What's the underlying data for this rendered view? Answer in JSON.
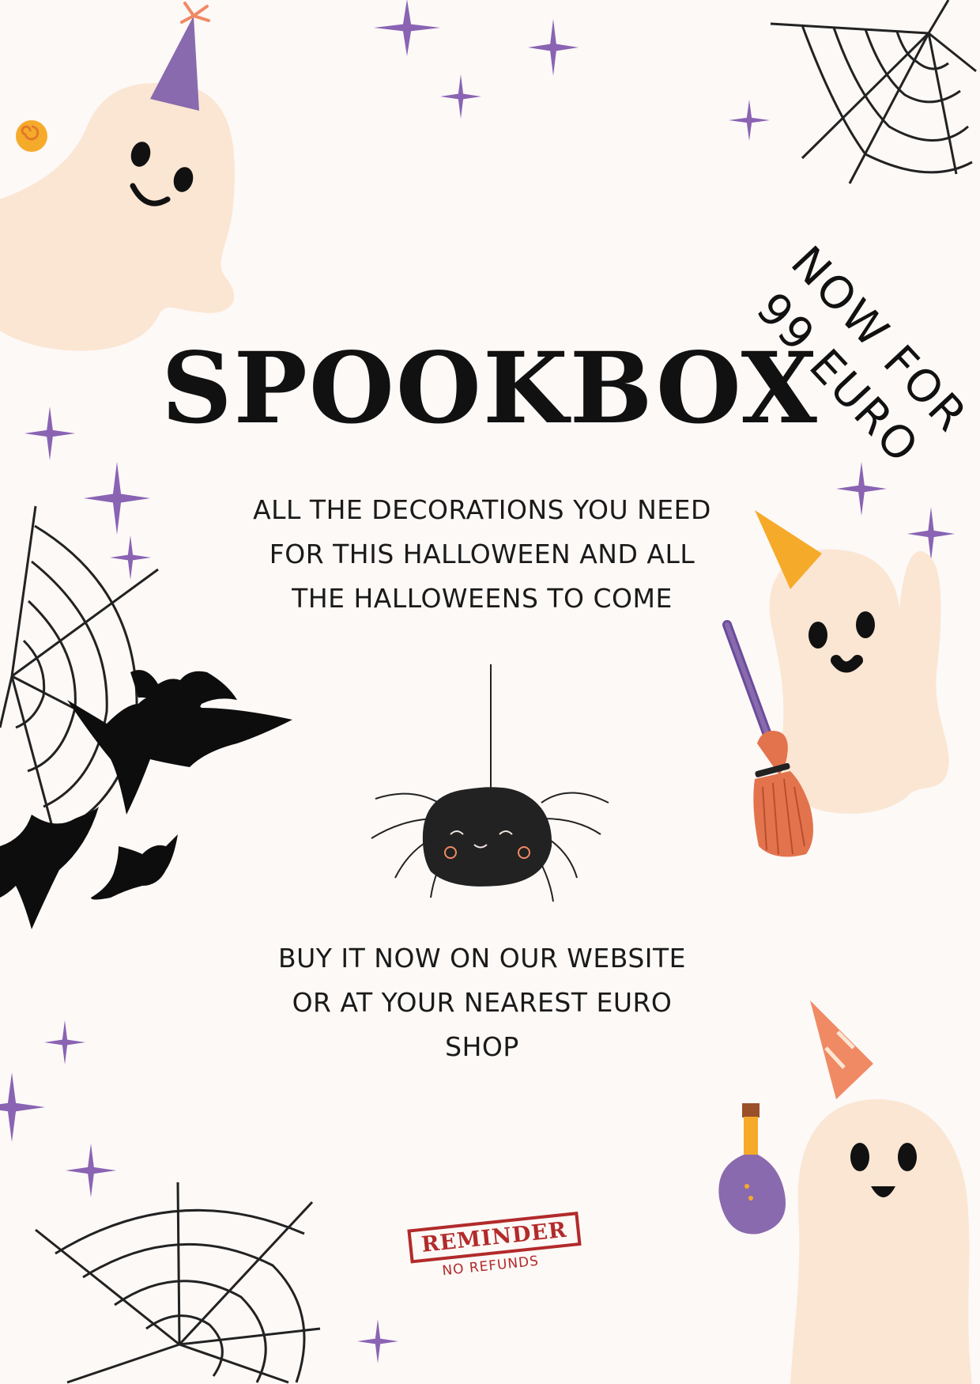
{
  "title": "SPOOKBOX",
  "promo": {
    "line1": "NOW FOR",
    "line2": "99 EURO"
  },
  "tagline": [
    "ALL THE DECORATIONS YOU NEED",
    "FOR THIS HALLOWEEN AND ALL",
    "THE HALLOWEENS TO COME"
  ],
  "cta": [
    "BUY IT NOW ON OUR WEBSITE",
    "OR AT YOUR NEAREST EURO",
    "SHOP"
  ],
  "stamp": {
    "label": "REMINDER",
    "note": "NO REFUNDS"
  },
  "icons": [
    "ghost-icon",
    "party-hat-icon",
    "spiderweb-icon",
    "sparkle-icon",
    "bat-icon",
    "spider-icon",
    "broom-icon",
    "potion-icon"
  ],
  "colors": {
    "background": "#fcf9f7",
    "ghost": "#fbe6d3",
    "sparkle": "#8a63b3",
    "hat_purple": "#8a6aae",
    "hat_orange": "#f6aa2a",
    "hat_coral": "#f08a64",
    "text": "#111111",
    "stamp": "#b22a2a"
  }
}
